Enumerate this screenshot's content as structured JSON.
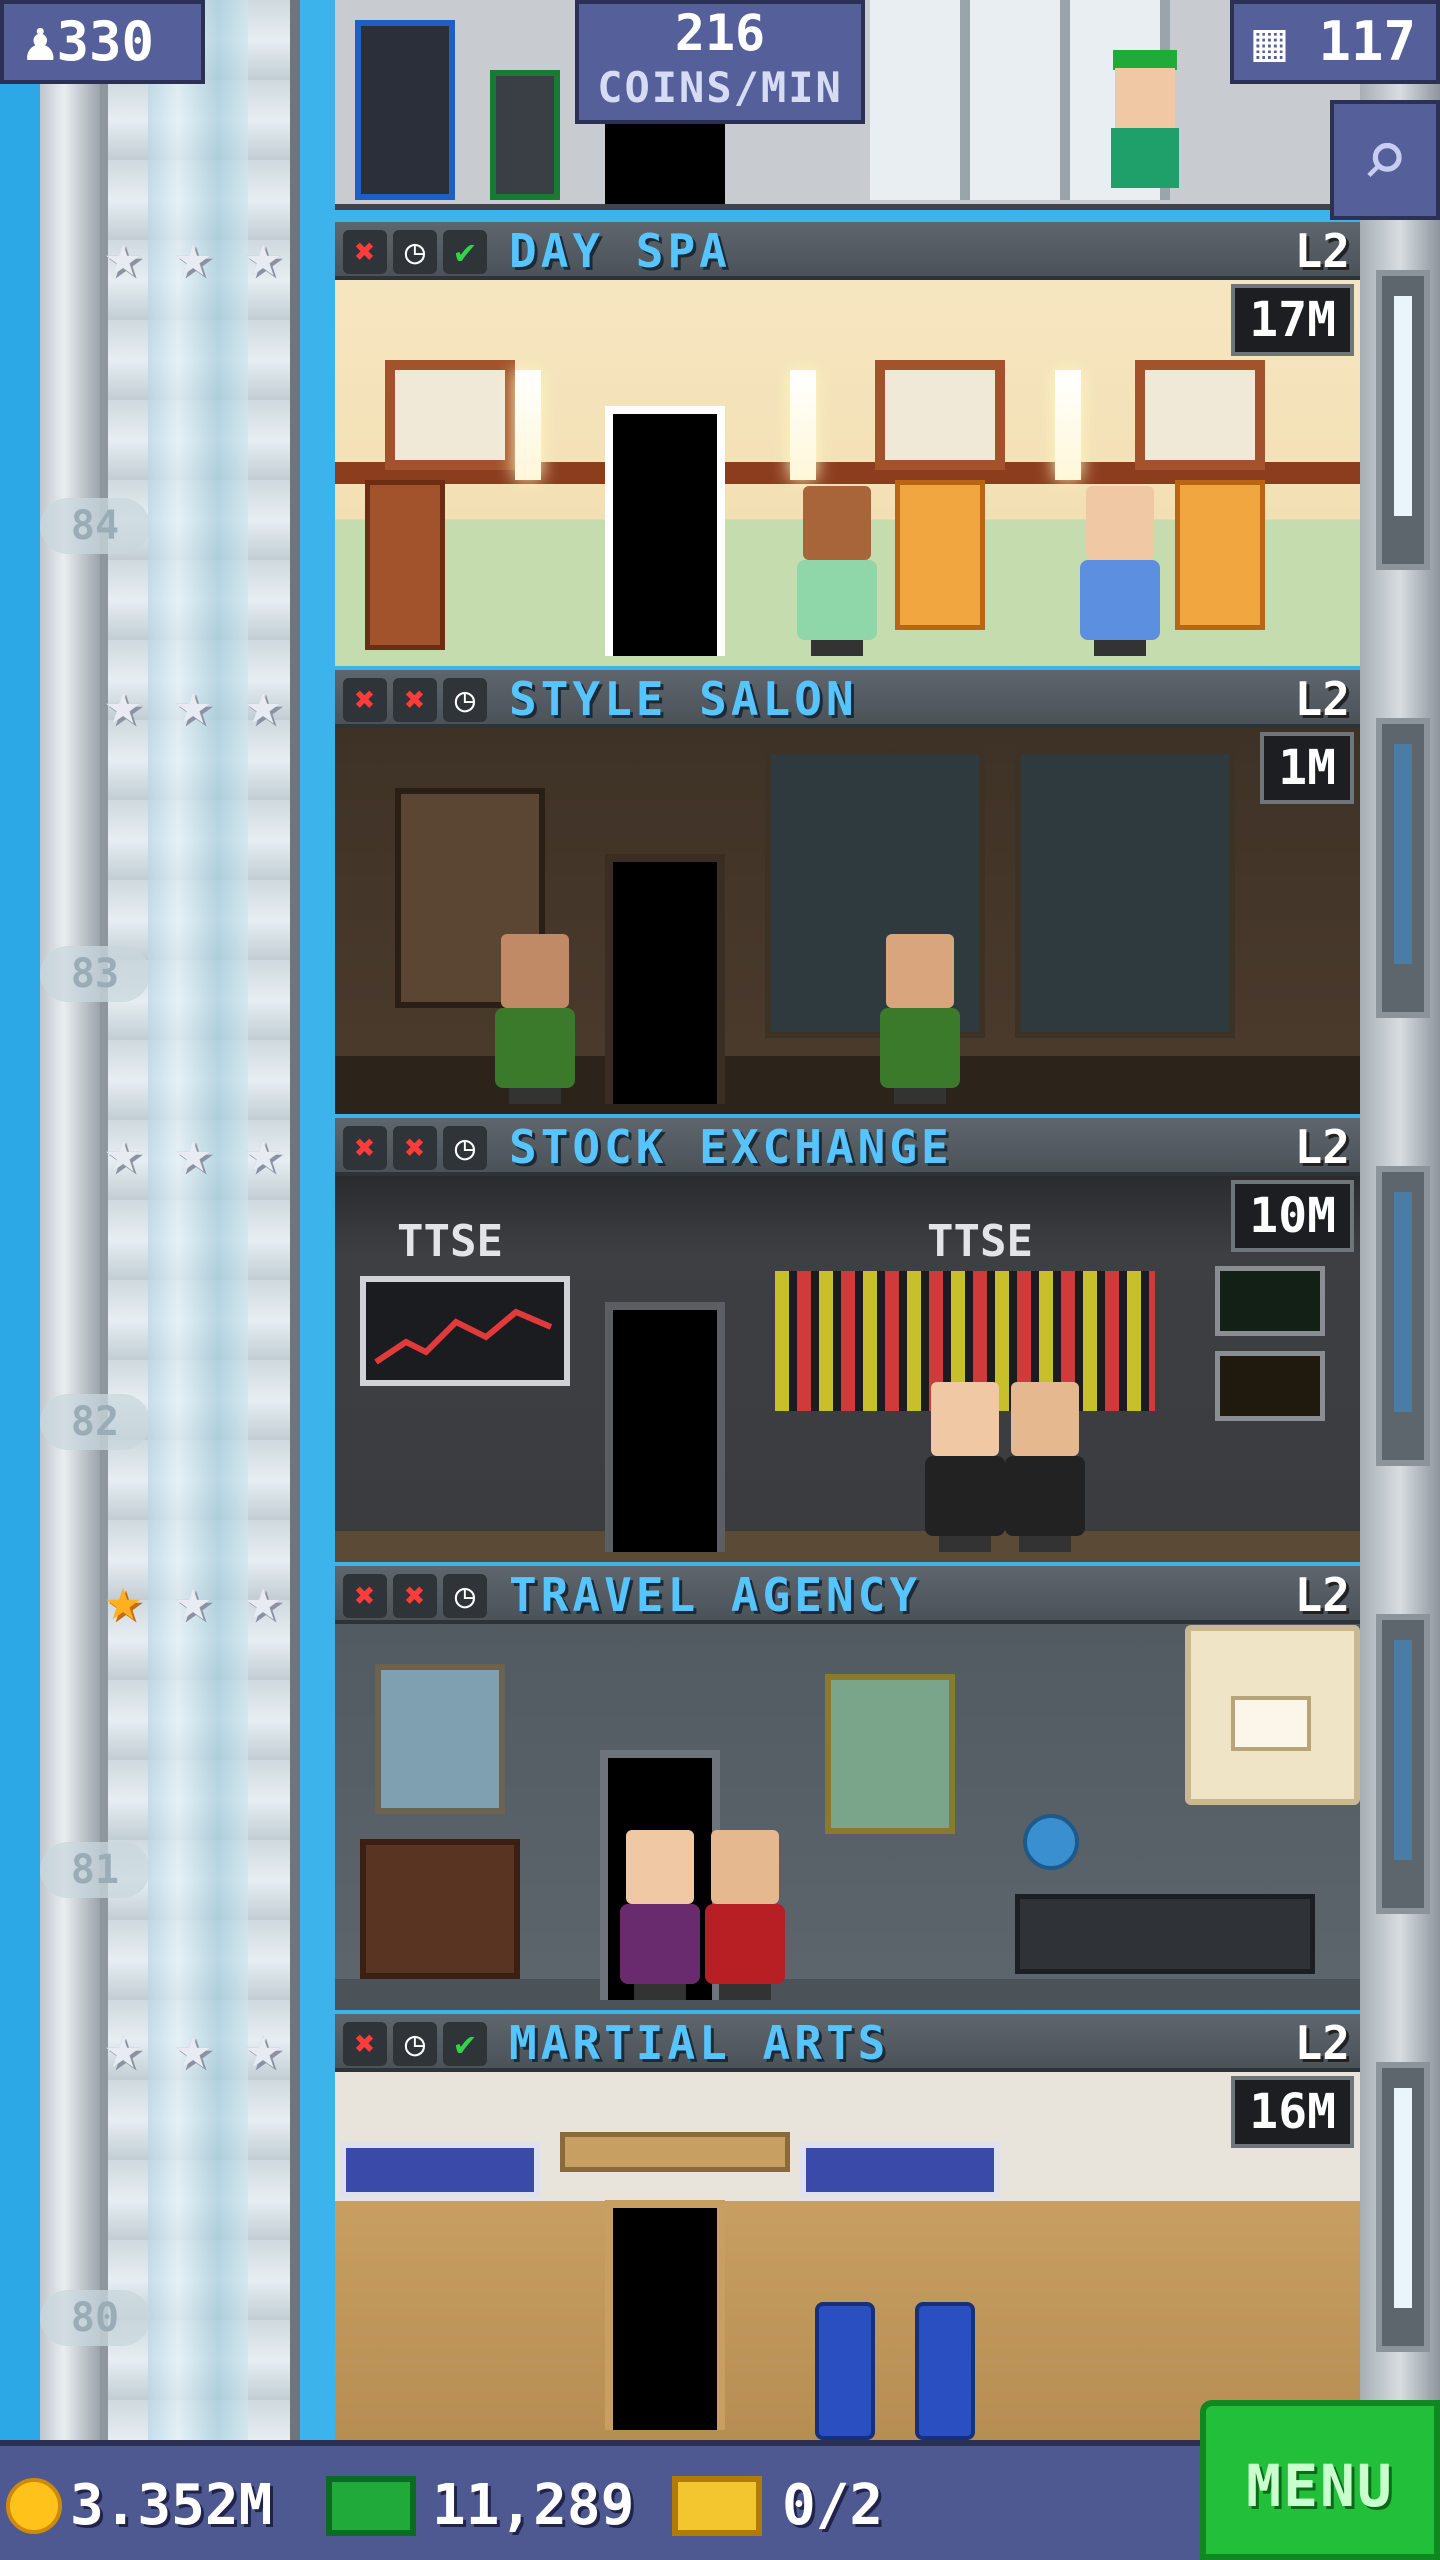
{
  "hud": {
    "population": "330",
    "coins_per_min_value": "216",
    "coins_per_min_label": "COINS/MIN",
    "floor_count": "117",
    "search_icon": "magnifier-icon"
  },
  "shaft_numbers": [
    "84",
    "83",
    "82",
    "81",
    "80"
  ],
  "floors": [
    {
      "name": "DAY SPA",
      "level": "L2",
      "stock": "17M",
      "status": [
        "x",
        "clock",
        "check"
      ],
      "stars": [
        "silver",
        "silver",
        "silver"
      ],
      "bg": "#f3e2b8",
      "floor_color": "#cfe2b7",
      "accent": "#8c3d1e"
    },
    {
      "name": "STYLE SALON",
      "level": "L2",
      "stock": "1M",
      "status": [
        "x",
        "x",
        "clock"
      ],
      "stars": [
        "silver",
        "silver",
        "silver"
      ],
      "bg": "#4a3a2c",
      "floor_color": "#2c231b",
      "accent": "#6b5840"
    },
    {
      "name": "STOCK EXCHANGE",
      "level": "L2",
      "stock": "10M",
      "status": [
        "x",
        "x",
        "clock"
      ],
      "stars": [
        "silver",
        "silver",
        "silver"
      ],
      "bg": "#3a3c40",
      "floor_color": "#2a2b2e",
      "accent": "#cfd3d8"
    },
    {
      "name": "TRAVEL AGENCY",
      "level": "L2",
      "stock": "",
      "status": [
        "x",
        "x",
        "clock"
      ],
      "stars": [
        "gold",
        "silver",
        "silver"
      ],
      "bg": "#5c646c",
      "floor_color": "#4b5258",
      "accent": "#7a6d5c"
    },
    {
      "name": "MARTIAL ARTS",
      "level": "L2",
      "stock": "16M",
      "status": [
        "x",
        "clock",
        "check"
      ],
      "stars": [
        "silver",
        "silver",
        "silver"
      ],
      "bg": "#e8e4dc",
      "floor_color": "#c89f63",
      "accent": "#5b3a1c"
    }
  ],
  "bottom": {
    "coins": "3.352M",
    "bux": "11,289",
    "tickets": "0/2",
    "menu_label": "MENU"
  },
  "texts": {
    "ttse1": "TTSE",
    "ttse2": "TTSE"
  }
}
